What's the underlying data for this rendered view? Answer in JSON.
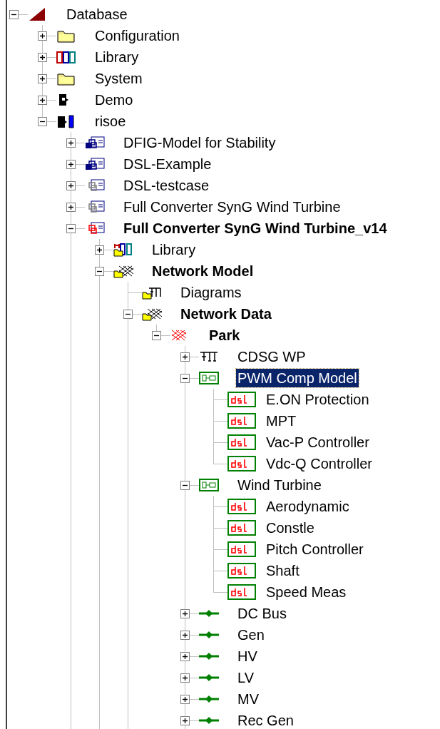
{
  "tree": [
    {
      "label": "Database",
      "kind": "database",
      "expanded": true,
      "bold": false,
      "selected": false,
      "children": [
        {
          "label": "Configuration",
          "kind": "folder",
          "expanded": false,
          "bold": false,
          "selected": false
        },
        {
          "label": "Library",
          "kind": "library",
          "expanded": false,
          "bold": false,
          "selected": false
        },
        {
          "label": "System",
          "kind": "folder",
          "expanded": false,
          "bold": false,
          "selected": false
        },
        {
          "label": "Demo",
          "kind": "user",
          "expanded": false,
          "bold": false,
          "selected": false
        },
        {
          "label": "risoe",
          "kind": "userdoc",
          "expanded": true,
          "bold": false,
          "selected": false,
          "children_continue": true,
          "children": [
            {
              "label": "DFIG-Model for Stability",
              "kind": "projectblue",
              "expanded": false,
              "bold": false,
              "selected": false
            },
            {
              "label": "DSL-Example",
              "kind": "projectblue",
              "expanded": false,
              "bold": false,
              "selected": false
            },
            {
              "label": "DSL-testcase",
              "kind": "projectgray",
              "expanded": false,
              "bold": false,
              "selected": false
            },
            {
              "label": "Full Converter SynG Wind Turbine",
              "kind": "projectgray",
              "expanded": false,
              "bold": false,
              "selected": false
            },
            {
              "label": "Full Converter SynG Wind Turbine_v14",
              "kind": "projectred",
              "expanded": true,
              "bold": true,
              "selected": false,
              "children_continue": true,
              "children": [
                {
                  "label": "Library",
                  "kind": "libraryfolder",
                  "expanded": false,
                  "bold": false,
                  "selected": false
                },
                {
                  "label": "Network Model",
                  "kind": "gridfolder",
                  "expanded": true,
                  "bold": true,
                  "selected": false,
                  "children_continue": true,
                  "children": [
                    {
                      "label": "Diagrams",
                      "kind": "diagramfolder",
                      "bold": false,
                      "selected": false
                    },
                    {
                      "label": "Network Data",
                      "kind": "gridfolder",
                      "expanded": true,
                      "bold": true,
                      "selected": false,
                      "children": [
                        {
                          "label": "Park",
                          "kind": "gridred",
                          "expanded": true,
                          "bold": true,
                          "selected": false,
                          "children_continue": true,
                          "children": [
                            {
                              "label": "CDSG WP",
                              "kind": "diagram",
                              "expanded": false,
                              "bold": false,
                              "selected": false
                            },
                            {
                              "label": "PWM Comp Model",
                              "kind": "composite",
                              "expanded": true,
                              "bold": false,
                              "selected": true,
                              "children": [
                                {
                                  "label": "E.ON Protection",
                                  "kind": "dsl",
                                  "bold": false,
                                  "selected": false
                                },
                                {
                                  "label": "MPT",
                                  "kind": "dsl",
                                  "bold": false,
                                  "selected": false
                                },
                                {
                                  "label": "Vac-P Controller",
                                  "kind": "dsl",
                                  "bold": false,
                                  "selected": false
                                },
                                {
                                  "label": "Vdc-Q Controller",
                                  "kind": "dsl",
                                  "bold": false,
                                  "selected": false
                                }
                              ]
                            },
                            {
                              "label": "Wind Turbine",
                              "kind": "composite",
                              "expanded": true,
                              "bold": false,
                              "selected": false,
                              "children": [
                                {
                                  "label": "Aerodynamic",
                                  "kind": "dsl",
                                  "bold": false,
                                  "selected": false
                                },
                                {
                                  "label": "Constle",
                                  "kind": "dsl",
                                  "bold": false,
                                  "selected": false
                                },
                                {
                                  "label": "Pitch Controller",
                                  "kind": "dsl",
                                  "bold": false,
                                  "selected": false
                                },
                                {
                                  "label": "Shaft",
                                  "kind": "dsl",
                                  "bold": false,
                                  "selected": false
                                },
                                {
                                  "label": "Speed Meas",
                                  "kind": "dsl",
                                  "bold": false,
                                  "selected": false
                                }
                              ]
                            },
                            {
                              "label": "DC Bus",
                              "kind": "terminal",
                              "expanded": false,
                              "bold": false,
                              "selected": false
                            },
                            {
                              "label": "Gen",
                              "kind": "terminal",
                              "expanded": false,
                              "bold": false,
                              "selected": false
                            },
                            {
                              "label": "HV",
                              "kind": "terminal",
                              "expanded": false,
                              "bold": false,
                              "selected": false
                            },
                            {
                              "label": "LV",
                              "kind": "terminal",
                              "expanded": false,
                              "bold": false,
                              "selected": false
                            },
                            {
                              "label": "MV",
                              "kind": "terminal",
                              "expanded": false,
                              "bold": false,
                              "selected": false
                            },
                            {
                              "label": "Rec Gen",
                              "kind": "terminal",
                              "expanded": false,
                              "bold": false,
                              "selected": false
                            }
                          ]
                        }
                      ]
                    }
                  ]
                }
              ]
            }
          ]
        }
      ]
    }
  ]
}
